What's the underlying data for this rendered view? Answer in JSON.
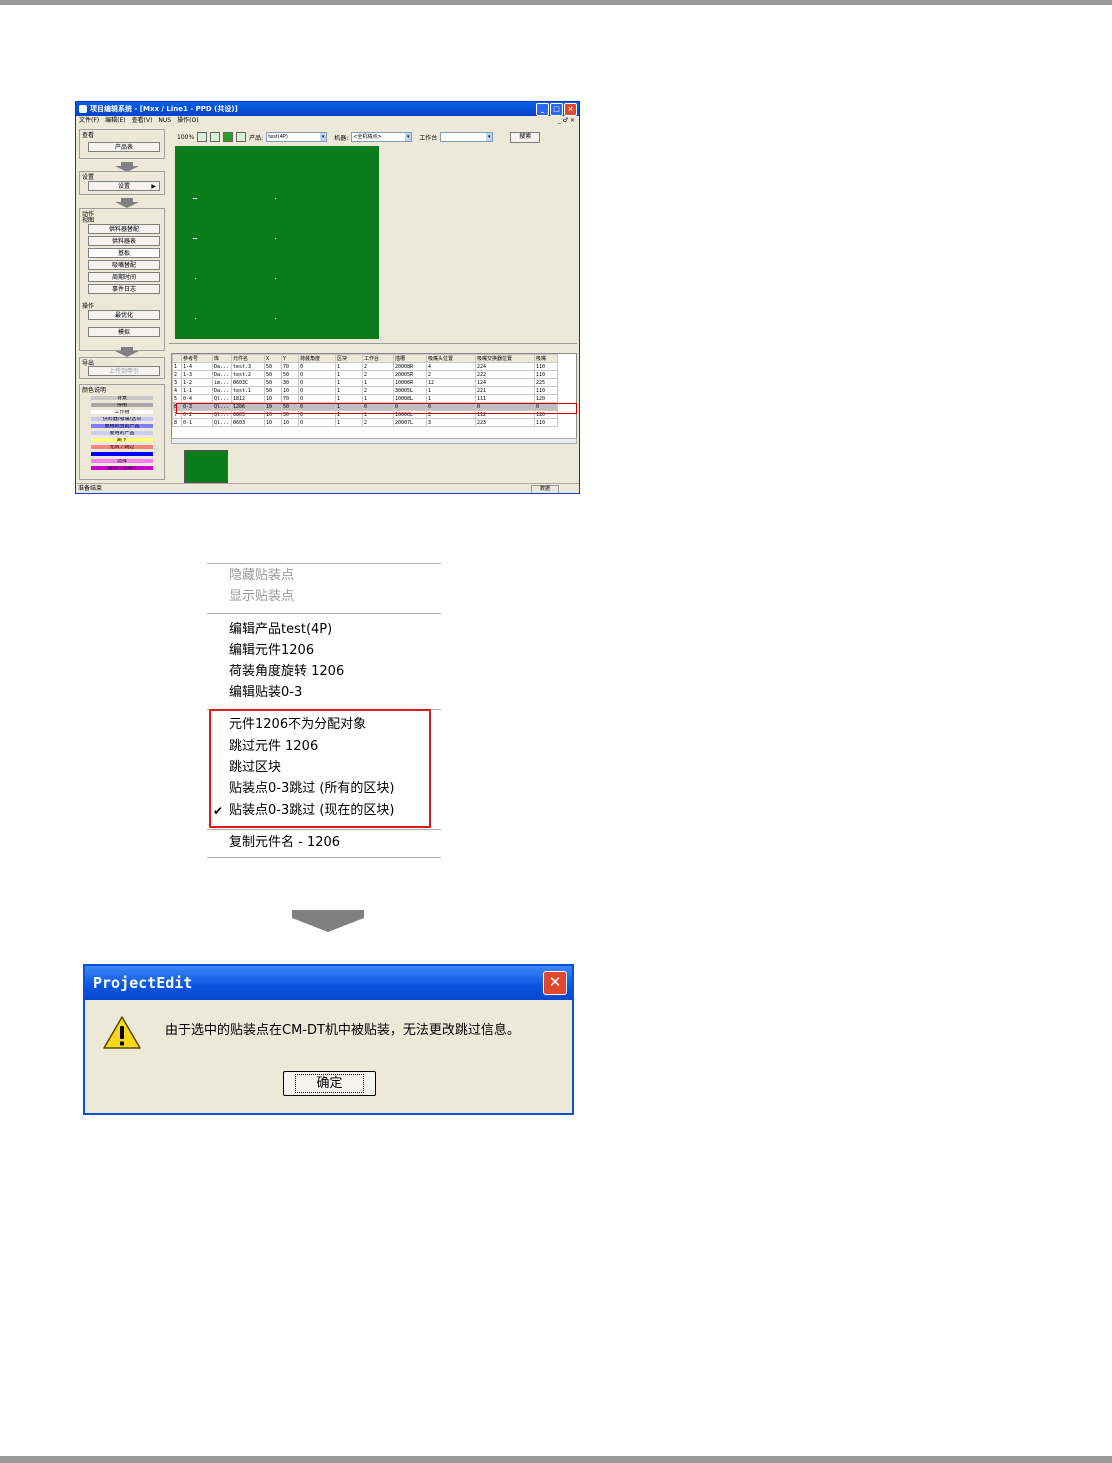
{
  "app": {
    "title": "项目编辑系统 - [Mxx / Line1 - PPD (共设)]",
    "menu": [
      "文件(F)",
      "编辑(E)",
      "查看(V)",
      "NUS",
      "操作(O)"
    ],
    "mdi_controls": "_ ♂ ×",
    "left_panel": {
      "view_group": "查看",
      "product_table_button": "产品表",
      "settings_group": "设置",
      "settings_button": "设置",
      "action_group": "动作",
      "view_sub_group": "视图",
      "feeder_assign_button": "供料器替配",
      "feeder_table_button": "供料器表",
      "board_button": "基板",
      "nozzle_assign_button": "吸嘴替配",
      "cycle_time_button": "周期时间",
      "event_log_button": "事件日志",
      "operation_group": "操作",
      "optimize_button": "最优化",
      "simulate_button": "模拟",
      "export_group": "导出",
      "upload_button": "上传到甲引",
      "color_legend_group": "颜色说明",
      "legend": [
        {
          "label": "背景",
          "color": "#c8c8c8"
        },
        {
          "label": "停用",
          "color": "#a8a8a8"
        },
        {
          "label": "工作槽",
          "color": "#ffffff"
        },
        {
          "label": "供料器/吸嘴/选项",
          "color": "#c8c8ff"
        },
        {
          "label": "要用的当前产品",
          "color": "#8080ff"
        },
        {
          "label": "要用的产品",
          "color": "#ccccff"
        },
        {
          "label": "跳下",
          "color": "#ffff80"
        },
        {
          "label": "无效 / 跳过",
          "color": "#ff8080"
        },
        {
          "label": "",
          "color": "#0000ff"
        },
        {
          "label": "选择",
          "color": "#ff80ff"
        },
        {
          "label": "选择 ( 控制 )",
          "color": "#cc00cc"
        }
      ]
    },
    "toolbar": {
      "zoom": "100%",
      "product_label": "产品:",
      "product_value": "test(4P)",
      "machine_label": "机器:",
      "machine_value": "<全机械点>",
      "table_label": "工作台",
      "table_value": "",
      "search_button": "搜索"
    },
    "grid": {
      "columns": [
        "",
        "参考号",
        "库",
        "元件名",
        "X",
        "Y",
        "荷装角度",
        "区块",
        "工作台",
        "插槽",
        "吸嘴头位置",
        "吸嘴交换器位置",
        "吸嘴"
      ],
      "rows": [
        [
          "1",
          "1-4",
          "Da...",
          "test.3",
          "50",
          "70",
          "0",
          "1",
          "2",
          "20008R",
          "4",
          "224",
          "110"
        ],
        [
          "2",
          "1-3",
          "Da...",
          "test.2",
          "50",
          "50",
          "0",
          "1",
          "2",
          "20005R",
          "2",
          "222",
          "110"
        ],
        [
          "3",
          "1-2",
          "im...",
          "0603C",
          "50",
          "30",
          "0",
          "1",
          "1",
          "10006R",
          "12",
          "124",
          "225"
        ],
        [
          "4",
          "1-1",
          "Da...",
          "test.1",
          "50",
          "10",
          "0",
          "1",
          "2",
          "30005L",
          "1",
          "221",
          "110"
        ],
        [
          "5",
          "0-4",
          "Ql...",
          "1812",
          "10",
          "70",
          "0",
          "1",
          "1",
          "10008L",
          "1",
          "111",
          "120"
        ],
        [
          "6",
          "0-3",
          "Ql...",
          "1206",
          "10",
          "50",
          "0",
          "1",
          "0",
          "0",
          "0",
          "0",
          "0"
        ],
        [
          "7",
          "0-2",
          "Ql...",
          "0805",
          "10",
          "30",
          "0",
          "1",
          "1",
          "10006L",
          "2",
          "112",
          "120"
        ],
        [
          "8",
          "0-1",
          "Ql...",
          "0603",
          "10",
          "10",
          "0",
          "1",
          "2",
          "20007L",
          "3",
          "223",
          "110"
        ]
      ],
      "selected_row": 5
    },
    "status": {
      "text": "准备结束",
      "cell": "数据"
    }
  },
  "context_menu": {
    "group1": [
      "隐藏贴装点",
      "显示贴装点"
    ],
    "group2": [
      "编辑产品test(4P)",
      "编辑元件1206",
      "荷装角度旋转 1206",
      "编辑贴装0-3"
    ],
    "group3": [
      "元件1206不为分配对象",
      "跳过元件 1206",
      "跳过区块",
      "贴装点0-3跳过 (所有的区块)",
      "贴装点0-3跳过 (现在的区块)"
    ],
    "checked_item": "贴装点0-3跳过 (现在的区块)",
    "group4": [
      "复制元件名 - 1206"
    ]
  },
  "dialog": {
    "title": "ProjectEdit",
    "message": "由于选中的贴装点在CM-DT机中被贴装，无法更改跳过信息。",
    "ok_button": "确定",
    "close": "✕"
  }
}
